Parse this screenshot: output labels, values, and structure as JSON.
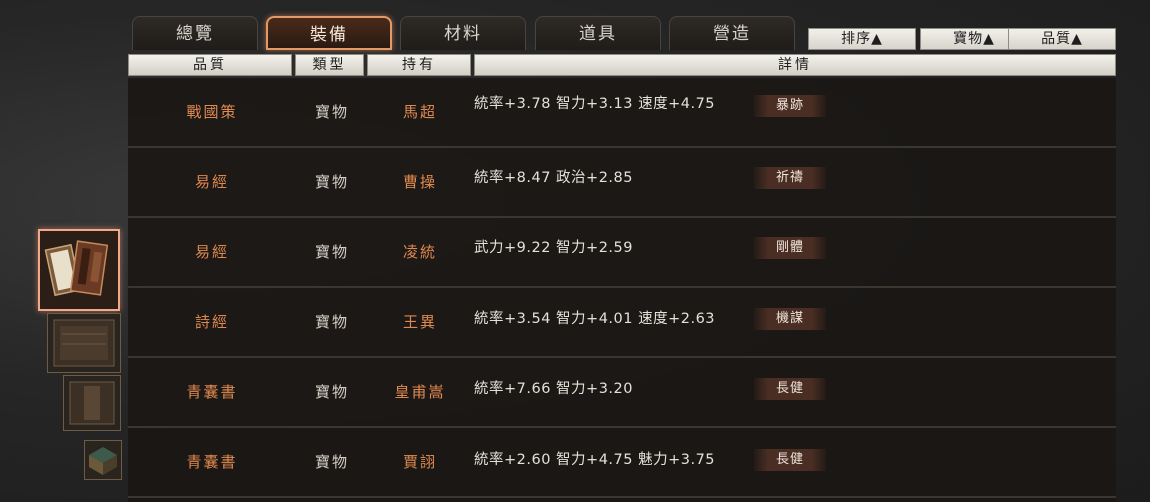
{
  "tabs": [
    {
      "label": "總覽",
      "active": false
    },
    {
      "label": "裝備",
      "active": true
    },
    {
      "label": "材料",
      "active": false
    },
    {
      "label": "道具",
      "active": false
    },
    {
      "label": "營造",
      "active": false
    }
  ],
  "sort_buttons": [
    {
      "label": "排序▲"
    },
    {
      "label": "寶物▲"
    },
    {
      "label": "品質▲"
    }
  ],
  "columns": {
    "quality": "品質",
    "type": "類型",
    "owner": "持有",
    "details": "詳情"
  },
  "rows": [
    {
      "quality": "戰國策",
      "type": "寶物",
      "owner": "馬超",
      "stats": "統率+3.78  智力+3.13  速度+4.75",
      "skill": "暴跡"
    },
    {
      "quality": "易經",
      "type": "寶物",
      "owner": "曹操",
      "stats": "統率+8.47  政治+2.85",
      "skill": "祈禱"
    },
    {
      "quality": "易經",
      "type": "寶物",
      "owner": "凌統",
      "stats": "武力+9.22  智力+2.59",
      "skill": "剛體"
    },
    {
      "quality": "詩經",
      "type": "寶物",
      "owner": "王異",
      "stats": "統率+3.54  智力+4.01  速度+2.63",
      "skill": "機謀"
    },
    {
      "quality": "青囊書",
      "type": "寶物",
      "owner": "皇甫嵩",
      "stats": "統率+7.66  智力+3.20",
      "skill": "長健"
    },
    {
      "quality": "青囊書",
      "type": "寶物",
      "owner": "賈詡",
      "stats": "統率+2.60  智力+4.75  魅力+3.75",
      "skill": "長健"
    }
  ],
  "colors": {
    "accent": "#e39a66",
    "quality_text": "#e0894f",
    "header_bg": "#e6e3dc"
  }
}
